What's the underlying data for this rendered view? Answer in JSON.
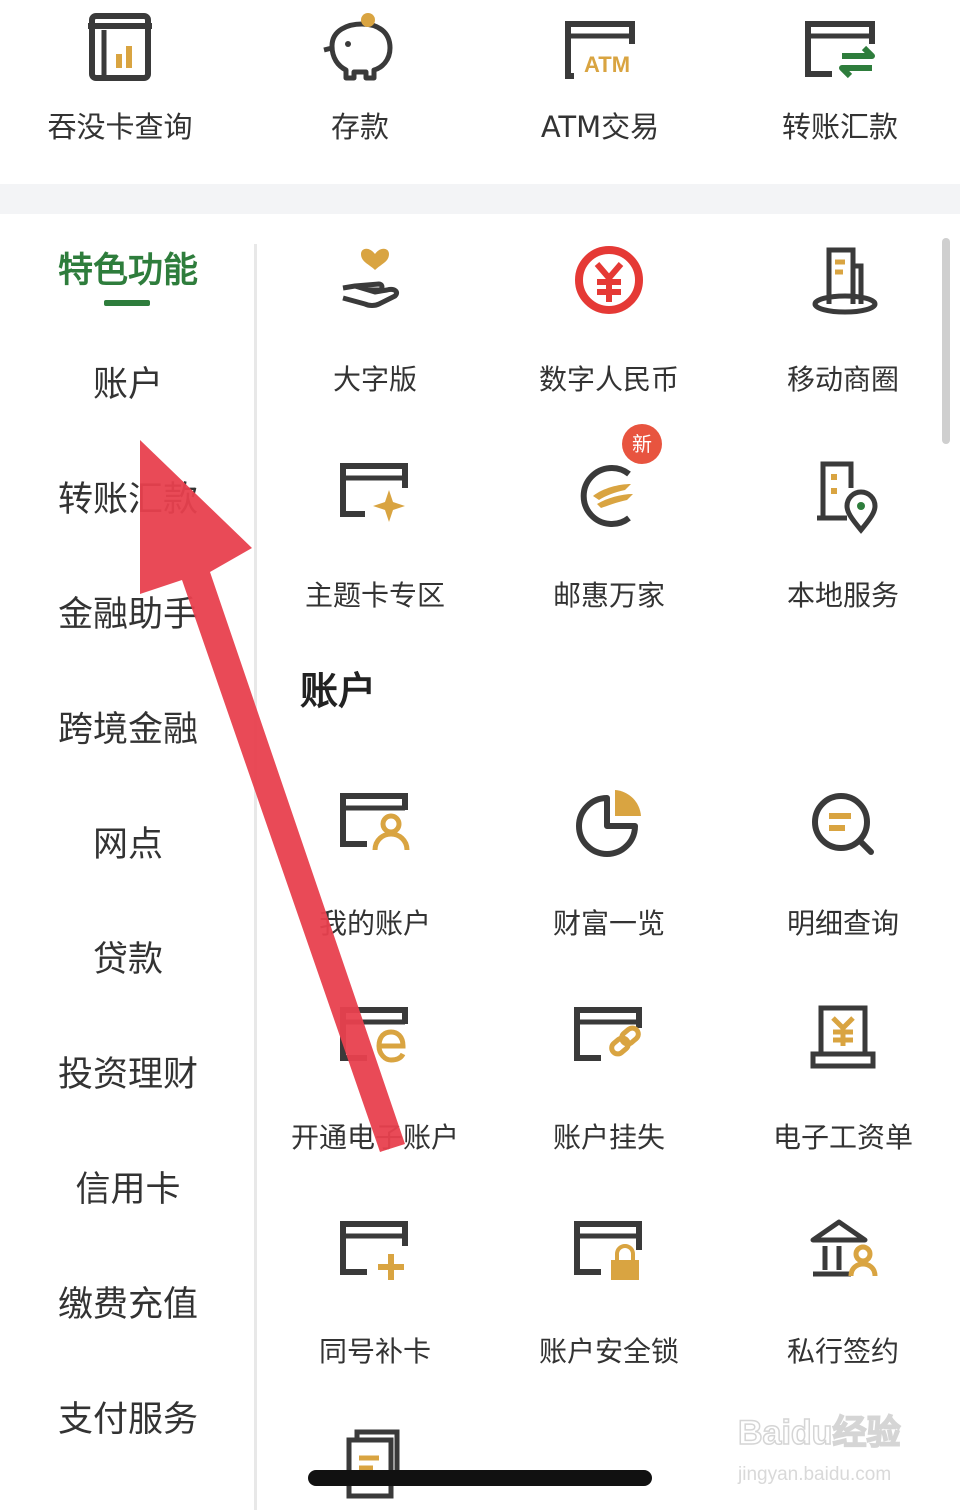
{
  "quick_actions": [
    {
      "label": "吞没卡查询",
      "icon": "card-query-icon"
    },
    {
      "label": "存款",
      "icon": "piggy-bank-icon"
    },
    {
      "label": "ATM交易",
      "icon": "atm-icon"
    },
    {
      "label": "转账汇款",
      "icon": "transfer-icon"
    }
  ],
  "atm_icon_text": "ATM",
  "sidebar": {
    "items": [
      {
        "label": "特色功能",
        "active": true
      },
      {
        "label": "账户"
      },
      {
        "label": "转账汇款"
      },
      {
        "label": "金融助手"
      },
      {
        "label": "跨境金融"
      },
      {
        "label": "网点"
      },
      {
        "label": "贷款"
      },
      {
        "label": "投资理财"
      },
      {
        "label": "信用卡"
      },
      {
        "label": "缴费充值"
      },
      {
        "label": "支付服务"
      }
    ]
  },
  "featured": [
    {
      "label": "大字版",
      "icon": "hand-heart-icon"
    },
    {
      "label": "数字人民币",
      "icon": "digital-rmb-icon"
    },
    {
      "label": "移动商圈",
      "icon": "mobile-business-icon"
    },
    {
      "label": "主题卡专区",
      "icon": "theme-card-icon"
    },
    {
      "label": "邮惠万家",
      "icon": "postal-benefit-icon",
      "badge": "新"
    },
    {
      "label": "本地服务",
      "icon": "local-service-icon"
    }
  ],
  "account_section": {
    "title": "账户",
    "items": [
      {
        "label": "我的账户",
        "icon": "my-account-icon"
      },
      {
        "label": "财富一览",
        "icon": "pie-chart-icon"
      },
      {
        "label": "明细查询",
        "icon": "search-detail-icon"
      },
      {
        "label": "开通电子账户",
        "icon": "e-account-icon"
      },
      {
        "label": "账户挂失",
        "icon": "report-loss-icon"
      },
      {
        "label": "电子工资单",
        "icon": "payslip-icon"
      },
      {
        "label": "同号补卡",
        "icon": "card-reissue-icon"
      },
      {
        "label": "账户安全锁",
        "icon": "security-lock-icon"
      },
      {
        "label": "私行签约",
        "icon": "private-bank-icon"
      }
    ]
  },
  "watermark": {
    "text": "Baidu经验",
    "url": "jingyan.baidu.com"
  },
  "colors": {
    "brand_green": "#2e7d3c",
    "accent_gold": "#d9a441",
    "dark_icon": "#3a3a3a",
    "red": "#e53935",
    "arrow": "#e8404e"
  }
}
